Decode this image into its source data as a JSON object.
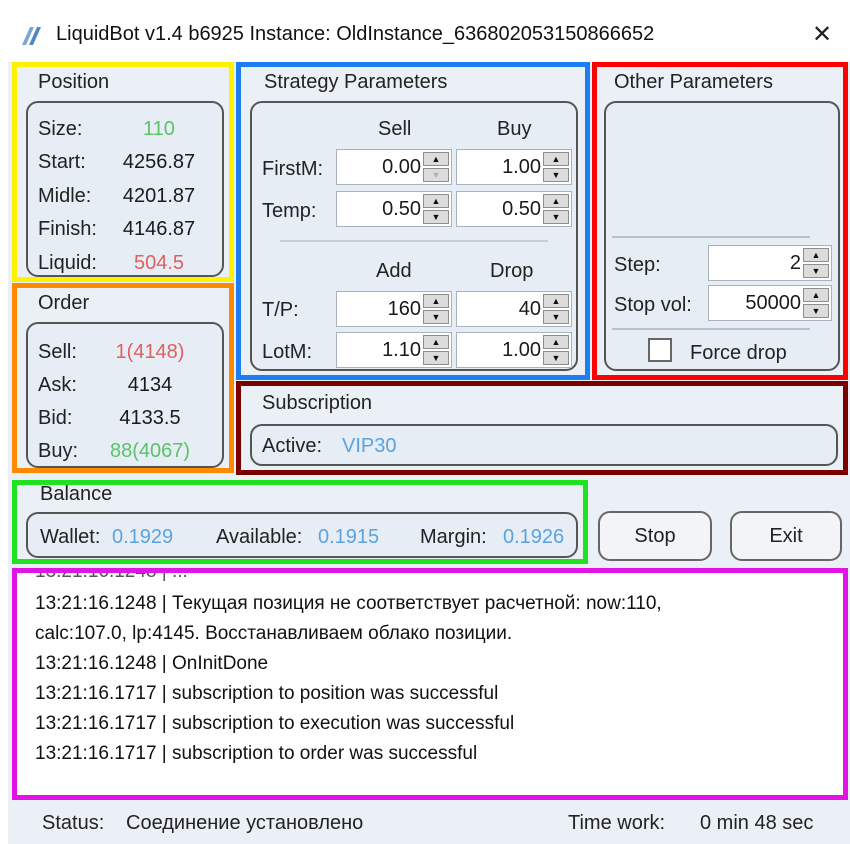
{
  "window": {
    "title": "LiquidBot v1.4 b6925 Instance: OldInstance_636802053150866652",
    "close_glyph": "✕"
  },
  "colors": {
    "position_frame": "#fff200",
    "order_frame": "#ff8a00",
    "strategy_frame": "#1c7ef0",
    "other_frame": "#ff0000",
    "subscription_frame": "#7a0000",
    "balance_frame": "#1fe31f",
    "log_frame": "#e213e5",
    "green_value": "#5cc26a",
    "red_value": "#e06060",
    "blue_value": "#5ba3e0",
    "log_warning": "#ef9630"
  },
  "position": {
    "label": "Position",
    "size_label": "Size:",
    "size_value": "110",
    "start_label": "Start:",
    "start_value": "4256.87",
    "midle_label": "Midle:",
    "midle_value": "4201.87",
    "finish_label": "Finish:",
    "finish_value": "4146.87",
    "liquid_label": "Liquid:",
    "liquid_value": "504.5"
  },
  "order": {
    "label": "Order",
    "sell_label": "Sell:",
    "sell_value": "1(4148)",
    "ask_label": "Ask:",
    "ask_value": "4134",
    "bid_label": "Bid:",
    "bid_value": "4133.5",
    "buy_label": "Buy:",
    "buy_value": "88(4067)"
  },
  "strategy": {
    "label": "Strategy Parameters",
    "col_sell": "Sell",
    "col_buy": "Buy",
    "firstm_label": "FirstM:",
    "firstm_sell": "0.00",
    "firstm_buy": "1.00",
    "temp_label": "Temp:",
    "temp_sell": "0.50",
    "temp_buy": "0.50",
    "col_add": "Add",
    "col_drop": "Drop",
    "tp_label": "T/P:",
    "tp_add": "160",
    "tp_drop": "40",
    "lotm_label": "LotM:",
    "lotm_add": "1.10",
    "lotm_drop": "1.00"
  },
  "other": {
    "label": "Other Parameters",
    "step_label": "Step:",
    "step_value": "2",
    "stopvol_label": "Stop vol:",
    "stopvol_value": "50000",
    "force_drop_label": "Force drop"
  },
  "subscription": {
    "label": "Subscription",
    "active_label": "Active:",
    "active_value": "VIP30"
  },
  "balance": {
    "label": "Balance",
    "wallet_label": "Wallet:",
    "wallet_value": "0.1929",
    "available_label": "Available:",
    "available_value": "0.1915",
    "margin_label": "Margin:",
    "margin_value": "0.1926"
  },
  "buttons": {
    "stop": "Stop",
    "exit": "Exit"
  },
  "log": {
    "lines": [
      "13:21:16.1248 | Текущая позиция не соответствует расчетной: now:110,",
      "calc:107.0, lp:4145. Восстанавливаем облако позиции.",
      "13:21:16.1248 | OnInitDone",
      "13:21:16.1717 | subscription to position was successful",
      "13:21:16.1717 | subscription to execution was successful",
      "13:21:16.1717 | subscription to order was successful"
    ]
  },
  "status": {
    "status_label": "Status:",
    "status_value": "Соединение установлено",
    "timework_label": "Time work:",
    "timework_value": "0 min 48 sec"
  }
}
